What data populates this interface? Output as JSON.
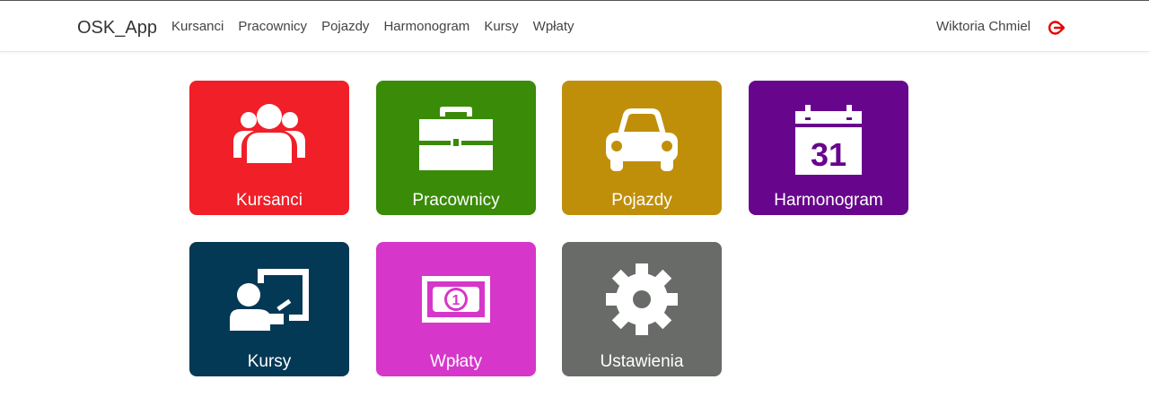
{
  "brand": "OSK_App",
  "nav": [
    "Kursanci",
    "Pracownicy",
    "Pojazdy",
    "Harmonogram",
    "Kursy",
    "Wpłaty"
  ],
  "user": "Wiktoria Chmiel",
  "logout_icon": "sign-out-icon",
  "tiles": [
    {
      "label": "Kursanci",
      "color": "#f01f28",
      "icon": "users-icon"
    },
    {
      "label": "Pracownicy",
      "color": "#3a8b08",
      "icon": "briefcase-icon"
    },
    {
      "label": "Pojazdy",
      "color": "#c08f0a",
      "icon": "car-icon"
    },
    {
      "label": "Harmonogram",
      "color": "#67068c",
      "icon": "calendar-icon",
      "icon_text": "31"
    },
    {
      "label": "Kursy",
      "color": "#043955",
      "icon": "presentation-icon"
    },
    {
      "label": "Wpłaty",
      "color": "#d636c9",
      "icon": "money-icon",
      "icon_text": "1"
    },
    {
      "label": "Ustawienia",
      "color": "#686b68",
      "icon": "gear-icon"
    }
  ]
}
